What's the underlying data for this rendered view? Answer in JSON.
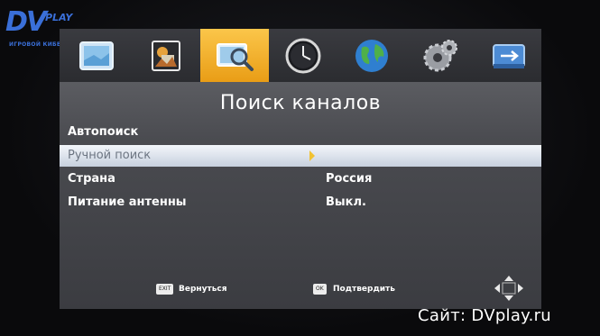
{
  "logo": {
    "main": "DV",
    "sub": "PLAY",
    "tagline": "ИГРОВОЙ КИБЕРЖУРНАЛ"
  },
  "icon_tabs": [
    {
      "name": "image-frame-icon",
      "active": false
    },
    {
      "name": "photos-icon",
      "active": false
    },
    {
      "name": "channel-search-icon",
      "active": true
    },
    {
      "name": "clock-icon",
      "active": false
    },
    {
      "name": "globe-icon",
      "active": false
    },
    {
      "name": "settings-gears-icon",
      "active": false
    },
    {
      "name": "usb-drive-icon",
      "active": false
    }
  ],
  "menu": {
    "title": "Поиск каналов",
    "items": [
      {
        "label": "Автопоиск",
        "value": ""
      },
      {
        "label": "Ручной поиск",
        "value": ""
      },
      {
        "label": "Страна",
        "value": "Россия"
      },
      {
        "label": "Питание антенны",
        "value": "Выкл."
      }
    ],
    "selected_index": 1
  },
  "footer": {
    "back_key": "EXIT",
    "back_label": "Вернуться",
    "confirm_key": "OK",
    "confirm_label": "Подтвердить"
  },
  "watermark": "Сайт: DVplay.ru",
  "colors": {
    "active_tab": "#f5b12e",
    "selected_row": "#dfe5ee",
    "screen_bg": "#4a4b50",
    "logo_blue": "#3a6fd8"
  }
}
